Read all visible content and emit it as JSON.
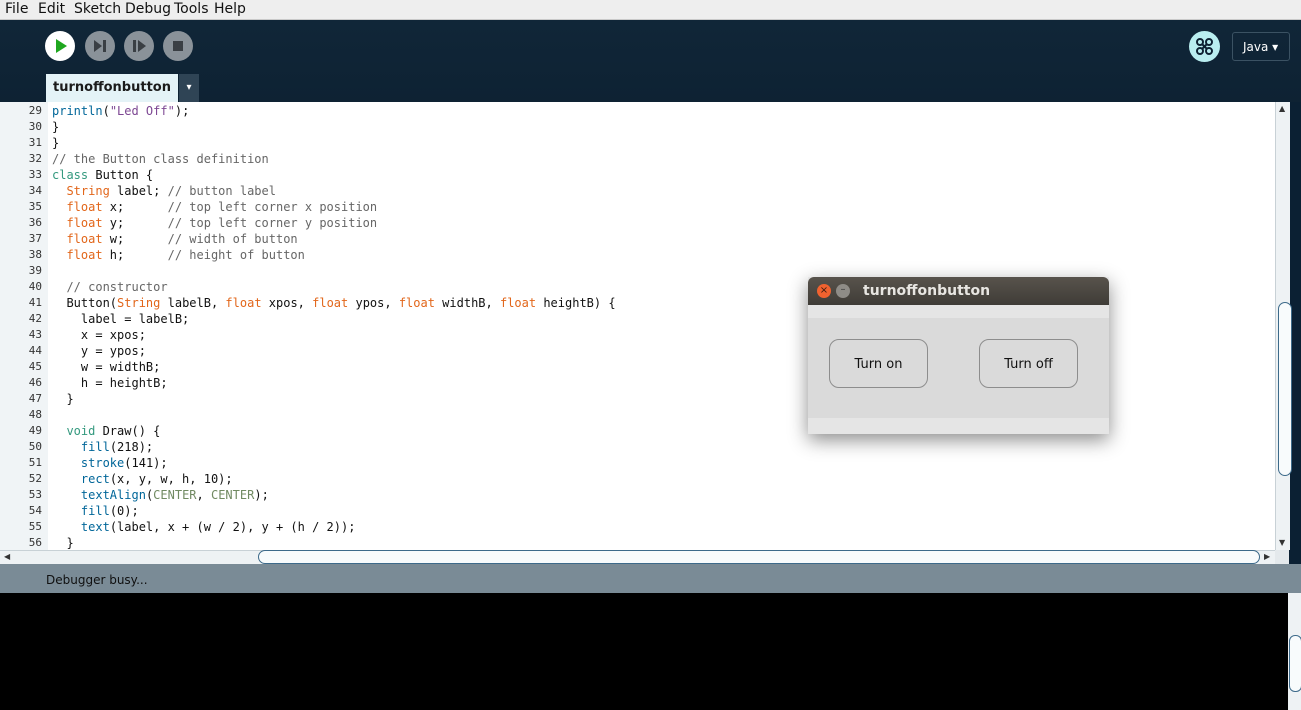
{
  "menu": [
    "File",
    "Edit",
    "Sketch",
    "Debug",
    "Tools",
    "Help"
  ],
  "toolbar": {
    "mode_label": "Java ▾"
  },
  "tab": {
    "name": "turnoffonbutton",
    "menu_glyph": "▾"
  },
  "code_lines": [
    {
      "num": "29",
      "text": "println(\"Led Off\");"
    },
    {
      "num": "30",
      "text": "}"
    },
    {
      "num": "31",
      "text": "}"
    },
    {
      "num": "32",
      "text": "// the Button class definition"
    },
    {
      "num": "33",
      "text": "class Button {"
    },
    {
      "num": "34",
      "text": "  String label; // button label"
    },
    {
      "num": "35",
      "text": "  float x;      // top left corner x position"
    },
    {
      "num": "36",
      "text": "  float y;      // top left corner y position"
    },
    {
      "num": "37",
      "text": "  float w;      // width of button"
    },
    {
      "num": "38",
      "text": "  float h;      // height of button"
    },
    {
      "num": "39",
      "text": ""
    },
    {
      "num": "40",
      "text": "  // constructor"
    },
    {
      "num": "41",
      "text": "  Button(String labelB, float xpos, float ypos, float widthB, float heightB) {"
    },
    {
      "num": "42",
      "text": "    label = labelB;"
    },
    {
      "num": "43",
      "text": "    x = xpos;"
    },
    {
      "num": "44",
      "text": "    y = ypos;"
    },
    {
      "num": "45",
      "text": "    w = widthB;"
    },
    {
      "num": "46",
      "text": "    h = heightB;"
    },
    {
      "num": "47",
      "text": "  }"
    },
    {
      "num": "48",
      "text": ""
    },
    {
      "num": "49",
      "text": "  void Draw() {"
    },
    {
      "num": "50",
      "text": "    fill(218);"
    },
    {
      "num": "51",
      "text": "    stroke(141);"
    },
    {
      "num": "52",
      "text": "    rect(x, y, w, h, 10);"
    },
    {
      "num": "53",
      "text": "    textAlign(CENTER, CENTER);"
    },
    {
      "num": "54",
      "text": "    fill(0);"
    },
    {
      "num": "55",
      "text": "    text(label, x + (w / 2), y + (h / 2));"
    },
    {
      "num": "56",
      "text": "  }"
    }
  ],
  "status": {
    "text": "Debugger busy..."
  },
  "dialog": {
    "title": "turnoffonbutton",
    "close_glyph": "×",
    "min_glyph": "–",
    "btn_on": "Turn on",
    "btn_off": "Turn off"
  }
}
